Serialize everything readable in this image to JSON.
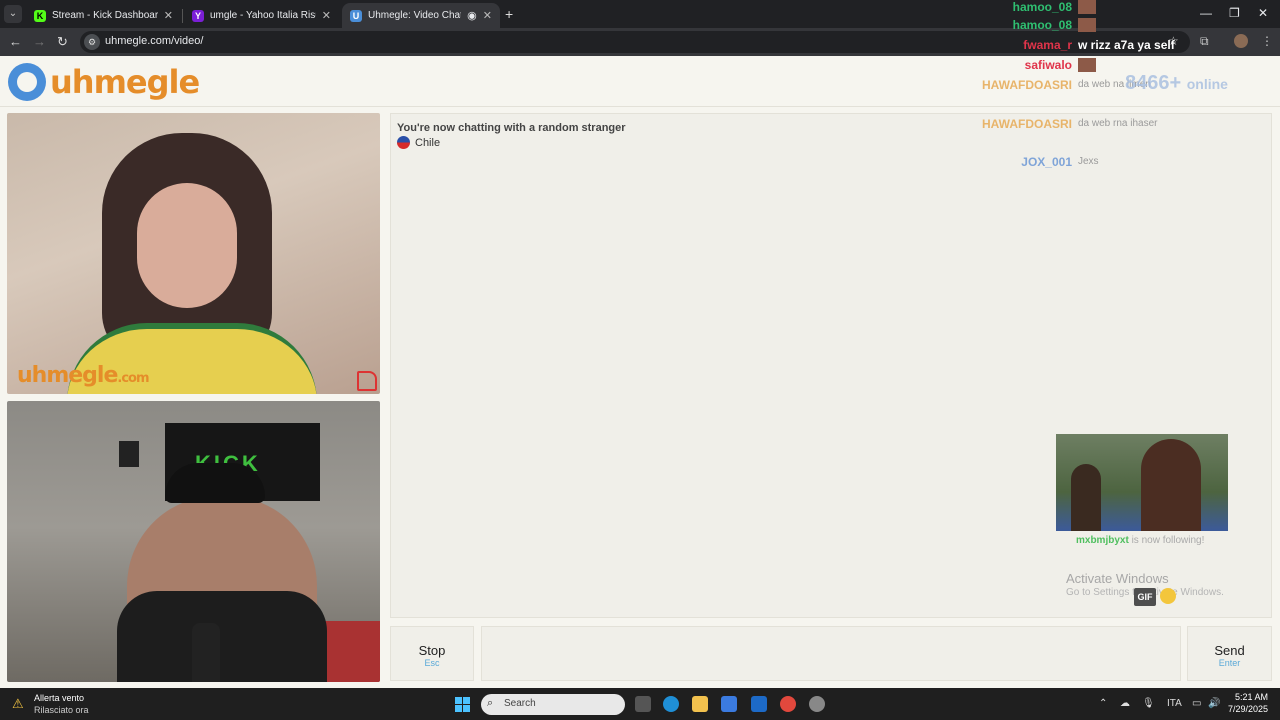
{
  "browser": {
    "tabs": [
      {
        "title": "Stream - Kick Dashboard",
        "favicon": "K",
        "color": "#53fc18"
      },
      {
        "title": "umgle - Yahoo Italia Risultati ri",
        "favicon": "Y",
        "color": "#7b1fd6"
      },
      {
        "title": "Uhmegle: Video Chat | Om",
        "favicon": "U",
        "color": "#4a8ed8"
      }
    ],
    "url": "uhmegle.com/video/"
  },
  "site": {
    "logo_text": "uhmegle",
    "watermark": "uhmegle",
    "watermark_suffix": ".com",
    "status_message": "You're now chatting with a random stranger",
    "country": "Chile",
    "stop_label": "Stop",
    "stop_key": "Esc",
    "send_label": "Send",
    "send_key": "Enter",
    "gif_label": "GIF",
    "online_count": "8466+",
    "online_label": "online"
  },
  "webcam": {
    "banner_text": "KICK"
  },
  "overlay_chat": [
    {
      "name": "hamoo_08",
      "color": "#2fbf71",
      "message": ""
    },
    {
      "name": "hamoo_08",
      "color": "#2fbf71",
      "message": ""
    },
    {
      "name": "fwama_r",
      "color": "#e0344a",
      "message": "w rizz a7a ya self"
    },
    {
      "name": "safiwalo",
      "color": "#e0344a",
      "message": ""
    },
    {
      "name": "HAWAFDOASRI",
      "color": "#e8b46a",
      "message": "da web na limen"
    },
    {
      "name": "HAWAFDOASRI",
      "color": "#e8b46a",
      "message": "da web rna ihaser"
    },
    {
      "name": "JOX_001",
      "color": "#7fa4d8",
      "message": "Jexs"
    }
  ],
  "follow_alert": {
    "user": "mxbmjbyxt",
    "text": "is now following!"
  },
  "windows_activation": {
    "title": "Activate Windows",
    "subtitle": "Go to Settings to activate Windows."
  },
  "taskbar": {
    "notification_title": "Allerta vento",
    "notification_sub": "Rilasciato ora",
    "search_placeholder": "Search",
    "language": "ITA",
    "time": "5:21 AM",
    "date": "7/29/2025"
  }
}
